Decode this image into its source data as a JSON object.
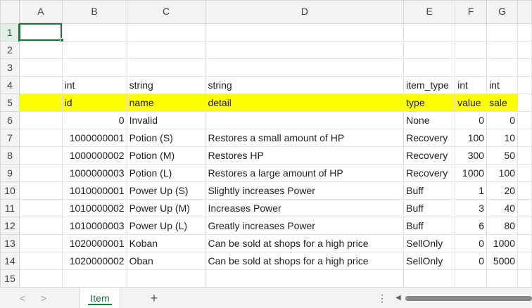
{
  "columns": [
    "A",
    "B",
    "C",
    "D",
    "E",
    "F",
    "G"
  ],
  "rows": [
    "1",
    "2",
    "3",
    "4",
    "5",
    "6",
    "7",
    "8",
    "9",
    "10",
    "11",
    "12",
    "13",
    "14",
    "15"
  ],
  "type_row": {
    "b": "int",
    "c": "string",
    "d": "string",
    "e": "item_type",
    "f": "int",
    "g": "int"
  },
  "field_row": {
    "b": "id",
    "c": "name",
    "d": "detail",
    "e": "type",
    "f": "value",
    "g": "sale"
  },
  "data": [
    {
      "id": "0",
      "name": "Invalid",
      "detail": "",
      "type": "None",
      "value": "0",
      "sale": "0"
    },
    {
      "id": "1000000001",
      "name": "Potion (S)",
      "detail": "Restores a small amount of HP",
      "type": "Recovery",
      "value": "100",
      "sale": "10"
    },
    {
      "id": "1000000002",
      "name": "Potion (M)",
      "detail": "Restores HP",
      "type": "Recovery",
      "value": "300",
      "sale": "50"
    },
    {
      "id": "1000000003",
      "name": "Potion (L)",
      "detail": "Restores a large amount of HP",
      "type": "Recovery",
      "value": "1000",
      "sale": "100"
    },
    {
      "id": "1010000001",
      "name": "Power Up (S)",
      "detail": "Slightly increases Power",
      "type": "Buff",
      "value": "1",
      "sale": "20"
    },
    {
      "id": "1010000002",
      "name": "Power Up (M)",
      "detail": "Increases Power",
      "type": "Buff",
      "value": "3",
      "sale": "40"
    },
    {
      "id": "1010000003",
      "name": "Power Up (L)",
      "detail": "Greatly increases Power",
      "type": "Buff",
      "value": "6",
      "sale": "80"
    },
    {
      "id": "1020000001",
      "name": "Koban",
      "detail": "Can be sold at shops for a high price",
      "type": "SellOnly",
      "value": "0",
      "sale": "1000"
    },
    {
      "id": "1020000002",
      "name": "Oban",
      "detail": "Can be sold at shops for a high price",
      "type": "SellOnly",
      "value": "0",
      "sale": "5000"
    }
  ],
  "tabs": {
    "prev": "<",
    "next": ">",
    "active_sheet": "Item",
    "add": "+",
    "more": "⋮"
  },
  "colors": {
    "accent": "#217346",
    "highlight": "#ffff00"
  }
}
